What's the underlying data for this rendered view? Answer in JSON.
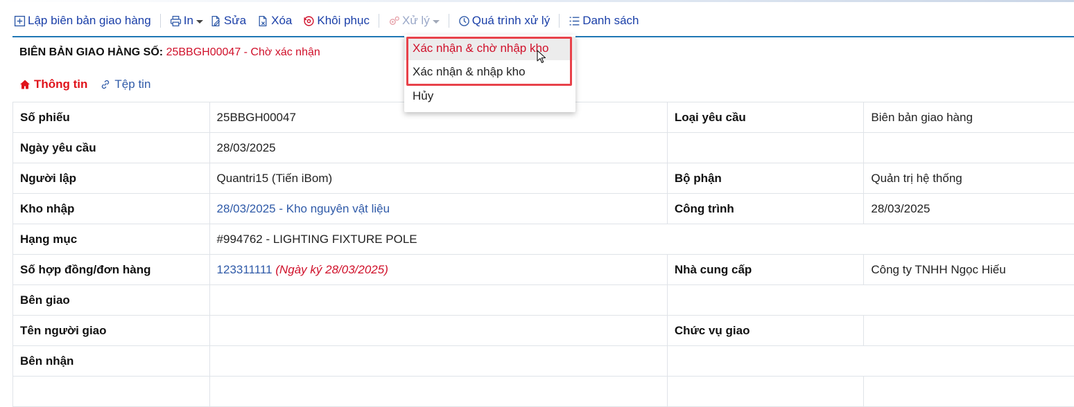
{
  "toolbar": {
    "create_label": "Lập biên bản giao hàng",
    "print_label": "In",
    "edit_label": "Sửa",
    "delete_label": "Xóa",
    "restore_label": "Khôi phục",
    "process_label": "Xử lý",
    "history_label": "Quá trình xử lý",
    "list_label": "Danh sách"
  },
  "header": {
    "title_prefix": "BIÊN BẢN GIAO HÀNG SỐ:",
    "code_status": "25BBGH00047 - Chờ xác nhận"
  },
  "tabs": {
    "info": "Thông tin",
    "files": "Tệp tin"
  },
  "dropdown": {
    "items": [
      "Xác nhận & chờ nhập kho",
      "Xác nhận & nhập kho",
      "Hủy"
    ]
  },
  "rows": [
    {
      "l1": "Số phiếu",
      "v1": "25BBGH00047",
      "l2": "Loại yêu cầu",
      "v2": "Biên bản giao hàng"
    },
    {
      "l1": "Ngày yêu cầu",
      "v1": "28/03/2025",
      "l2": "",
      "v2": ""
    },
    {
      "l1": "Người lập",
      "v1": "Quantri15 (Tiến iBom)",
      "l2": "Bộ phận",
      "v2": "Quản trị hệ thống"
    },
    {
      "l1": "Kho nhập",
      "v1": "28/03/2025 - Kho nguyên vật liệu",
      "l2": "Công trình",
      "v2": "28/03/2025"
    },
    {
      "l1": "Hạng mục",
      "v1": "#994762 - LIGHTING FIXTURE POLE"
    },
    {
      "l1": "Số hợp đồng/đơn hàng",
      "v1": "123311111",
      "v1_note": "(Ngày ký 28/03/2025)",
      "l2": "Nhà cung cấp",
      "v2": "Công ty TNHH Ngọc Hiếu"
    },
    {
      "l1": "Bên giao",
      "v1": ""
    },
    {
      "l1": "Tên người giao",
      "v1": "",
      "l2": "Chức vụ giao",
      "v2": ""
    },
    {
      "l1": "Bên nhận",
      "v1": ""
    },
    {
      "l1": "",
      "v1": "",
      "l2": "",
      "v2": ""
    }
  ]
}
